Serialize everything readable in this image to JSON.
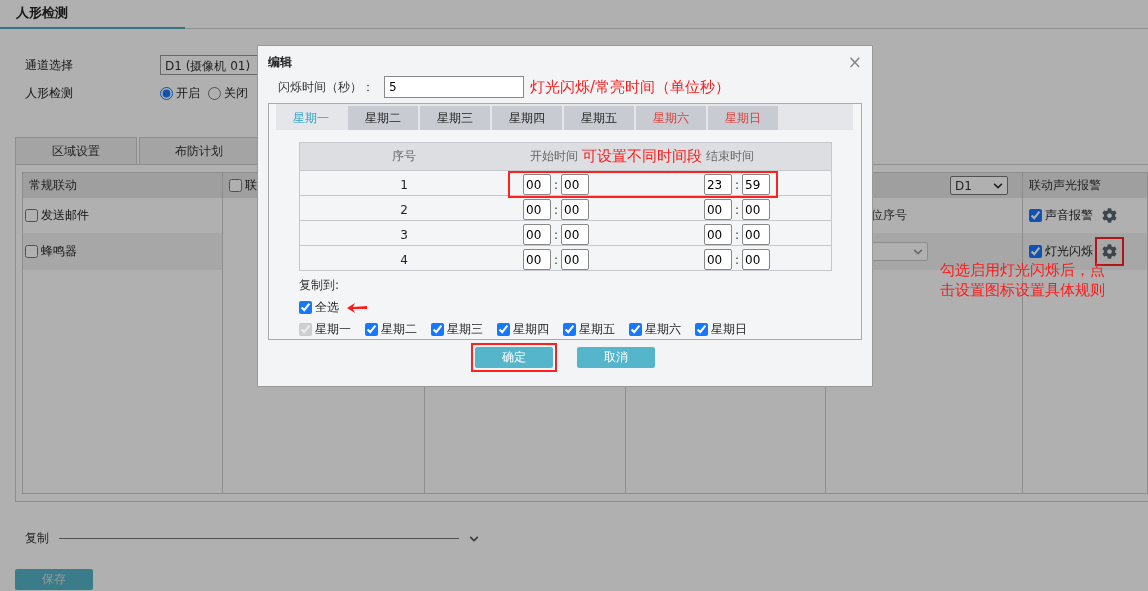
{
  "page": {
    "title": "人形检测"
  },
  "channel": {
    "label": "通道选择",
    "value": "D1 (摄像机 01)"
  },
  "detection": {
    "label": "人形检测",
    "options": [
      {
        "label": "开启",
        "selected": true
      },
      {
        "label": "关闭",
        "selected": false
      }
    ]
  },
  "tabs": [
    {
      "label": "区域设置",
      "selected": false
    },
    {
      "label": "布防计划",
      "selected": false
    }
  ],
  "linkage": {
    "general": {
      "header": "常规联动",
      "items": [
        {
          "label": "发送邮件",
          "checked": false
        },
        {
          "label": "蜂鸣器",
          "checked": false
        }
      ]
    },
    "column_2": {
      "header": "联",
      "checked": false
    },
    "column_5": {
      "select": "D1",
      "row_label": "位序号"
    },
    "alarm": {
      "header": "联动声光报警",
      "items": [
        {
          "label": "声音报警",
          "checked": true,
          "highlighted": false
        },
        {
          "label": "灯光闪烁",
          "checked": true,
          "highlighted": true
        }
      ]
    }
  },
  "copy": {
    "label": "复制"
  },
  "save_button": "保存",
  "dialog": {
    "title": "编辑",
    "close": "×",
    "flash_time": {
      "label": "闪烁时间（秒）：",
      "value": "5",
      "note": "灯光闪烁/常亮时间（单位秒）"
    },
    "days": [
      {
        "label": "星期一",
        "selected": true,
        "weekend": false
      },
      {
        "label": "星期二",
        "selected": false,
        "weekend": false
      },
      {
        "label": "星期三",
        "selected": false,
        "weekend": false
      },
      {
        "label": "星期四",
        "selected": false,
        "weekend": false
      },
      {
        "label": "星期五",
        "selected": false,
        "weekend": false
      },
      {
        "label": "星期六",
        "selected": false,
        "weekend": true
      },
      {
        "label": "星期日",
        "selected": false,
        "weekend": true
      }
    ],
    "table": {
      "columns": [
        "序号",
        "开始时间",
        "结束时间"
      ],
      "note": "可设置不同时间段",
      "separator": ":",
      "rows": [
        {
          "index": "1",
          "start": [
            "00",
            "00"
          ],
          "end": [
            "23",
            "59"
          ],
          "highlighted": true
        },
        {
          "index": "2",
          "start": [
            "00",
            "00"
          ],
          "end": [
            "00",
            "00"
          ],
          "highlighted": false
        },
        {
          "index": "3",
          "start": [
            "00",
            "00"
          ],
          "end": [
            "00",
            "00"
          ],
          "highlighted": false
        },
        {
          "index": "4",
          "start": [
            "00",
            "00"
          ],
          "end": [
            "00",
            "00"
          ],
          "highlighted": false
        }
      ]
    },
    "copy_to": {
      "label": "复制到:",
      "select_all": {
        "label": "全选",
        "checked": true
      },
      "days": [
        {
          "label": "星期一",
          "checked": true,
          "disabled": true
        },
        {
          "label": "星期二",
          "checked": true,
          "disabled": false
        },
        {
          "label": "星期三",
          "checked": true,
          "disabled": false
        },
        {
          "label": "星期四",
          "checked": true,
          "disabled": false
        },
        {
          "label": "星期五",
          "checked": true,
          "disabled": false
        },
        {
          "label": "星期六",
          "checked": true,
          "disabled": false
        },
        {
          "label": "星期日",
          "checked": true,
          "disabled": false
        }
      ]
    },
    "buttons": [
      {
        "label": "确定",
        "highlighted": true
      },
      {
        "label": "取消",
        "highlighted": false
      }
    ]
  },
  "annotation": "勾选启用灯光闪烁后，点击设置图标设置具体规则"
}
